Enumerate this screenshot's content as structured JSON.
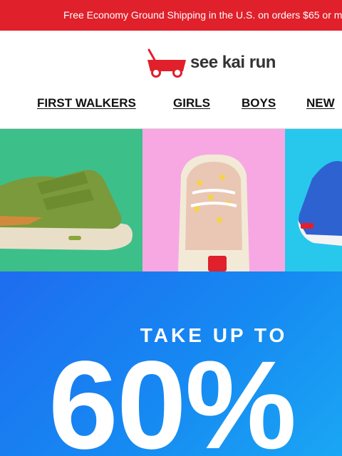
{
  "promo": {
    "text": "Free Economy Ground Shipping in the U.S. on orders $65 or m"
  },
  "brand": {
    "name": "see kai run",
    "logo_icon": "red-wagon-icon",
    "accent": "#e0202b"
  },
  "nav": {
    "items": [
      {
        "label": "FIRST WALKERS"
      },
      {
        "label": "GIRLS"
      },
      {
        "label": "BOYS"
      },
      {
        "label": "NEW"
      }
    ]
  },
  "tiles": [
    {
      "name": "olive green sneaker",
      "bg": "#3dbf8a"
    },
    {
      "name": "floral toddler sneaker",
      "bg": "#f7a8e3"
    },
    {
      "name": "blue sneaker",
      "bg": "#28c8ec"
    }
  ],
  "hero": {
    "pre": "TAKE UP TO",
    "big": "60%"
  }
}
